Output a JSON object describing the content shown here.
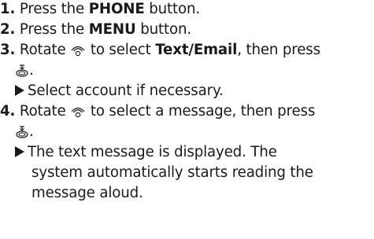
{
  "steps": [
    {
      "number": "1.",
      "pre": "Press the",
      "bold": "PHONE",
      "post": "button."
    },
    {
      "number": "2.",
      "pre": "Press the",
      "bold": "MENU",
      "post": "button."
    },
    {
      "number": "3.",
      "pre": "Rotate",
      "mid": "to select",
      "bold": "Text/Email",
      "post": ", then press",
      "end": ".",
      "note": "Select account if necessary."
    },
    {
      "number": "4.",
      "pre": "Rotate",
      "post": "to select a message, then press",
      "end": ".",
      "note_lines": [
        "The text message is displayed. The",
        "system automatically starts reading the",
        "message aloud."
      ]
    }
  ],
  "icons": {
    "rotate": "interface-dial-rotate-icon",
    "press": "interface-dial-press-icon"
  }
}
